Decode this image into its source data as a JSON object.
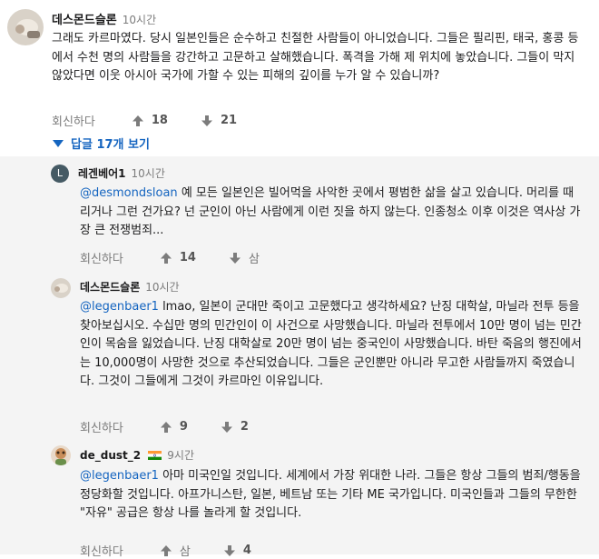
{
  "top_comment": {
    "author": "데스몬드슬론",
    "time": "10시간",
    "text": "그래도 카르마였다. 당시 일본인들은 순수하고 친절한 사람들이 아니었습니다. 그들은 필리핀, 태국, 홍콩 등에서 수천 명의 사람들을 강간하고 고문하고 살해했습니다. 폭격을 가해 제 위치에 놓았습니다. 그들이 막지 않았다면 이웃 아시아 국가에 가할 수 있는 피해의 깊이를 누가 알 수 있습니까?",
    "reply_label": "회신하다",
    "upvotes": "18",
    "downvotes": "21",
    "show_replies": "답글 17개 보기"
  },
  "replies": [
    {
      "author": "레겐베어1",
      "time": "10시간",
      "avatar_letter": "L",
      "mention": "@desmondsloan",
      "text": " 예 모든 일본인은 빌어먹을 사악한 곳에서 평범한 삶을 살고 있습니다. 머리를 때리거나 그런 건가요? 넌 군인이 아닌 사람에게 이런 짓을 하지 않는다. 인종청소 이후 이것은 역사상 가장 큰 전쟁범죄...",
      "reply_label": "회신하다",
      "upvotes": "14",
      "downvote_label": "삼"
    },
    {
      "author": "데스몬드슬론",
      "time": "10시간",
      "mention": "@legenbaer1",
      "text": " lmao, 일본이 군대만 죽이고 고문했다고 생각하세요? 난징 대학살, 마닐라 전투 등을 찾아보십시오. 수십만 명의 민간인이 이 사건으로 사망했습니다. 마닐라 전투에서 10만 명이 넘는 민간인이 목숨을 잃었습니다. 난징 대학살로 20만 명이 넘는 중국인이 사망했습니다. 바탄 죽음의 행진에서는 10,000명이 사망한 것으로 추산되었습니다. 그들은 군인뿐만 아니라 무고한 사람들까지 죽였습니다. 그것이 그들에게 그것이 카르마인 이유입니다.",
      "reply_label": "회신하다",
      "upvotes": "9",
      "downvotes": "2"
    },
    {
      "author": "de_dust_2",
      "time": "9시간",
      "mention": "@legenbaer1",
      "text": " 아마 미국인일 것입니다. 세계에서 가장 위대한 나라. 그들은 항상 그들의 범죄/행동을 정당화할 것입니다. 아프가니스탄, 일본, 베트남 또는 기타 ME 국가입니다. 미국인들과 그들의 무한한 \"자유\" 공급은 항상 나를 놀라게 할 것입니다.",
      "reply_label": "회신하다",
      "upvote_label": "삼",
      "downvotes": "4"
    }
  ],
  "colors": {
    "link_blue": "#1565c0",
    "reply_background": "#f4f4f4",
    "muted_text": "#7c7c7c"
  }
}
